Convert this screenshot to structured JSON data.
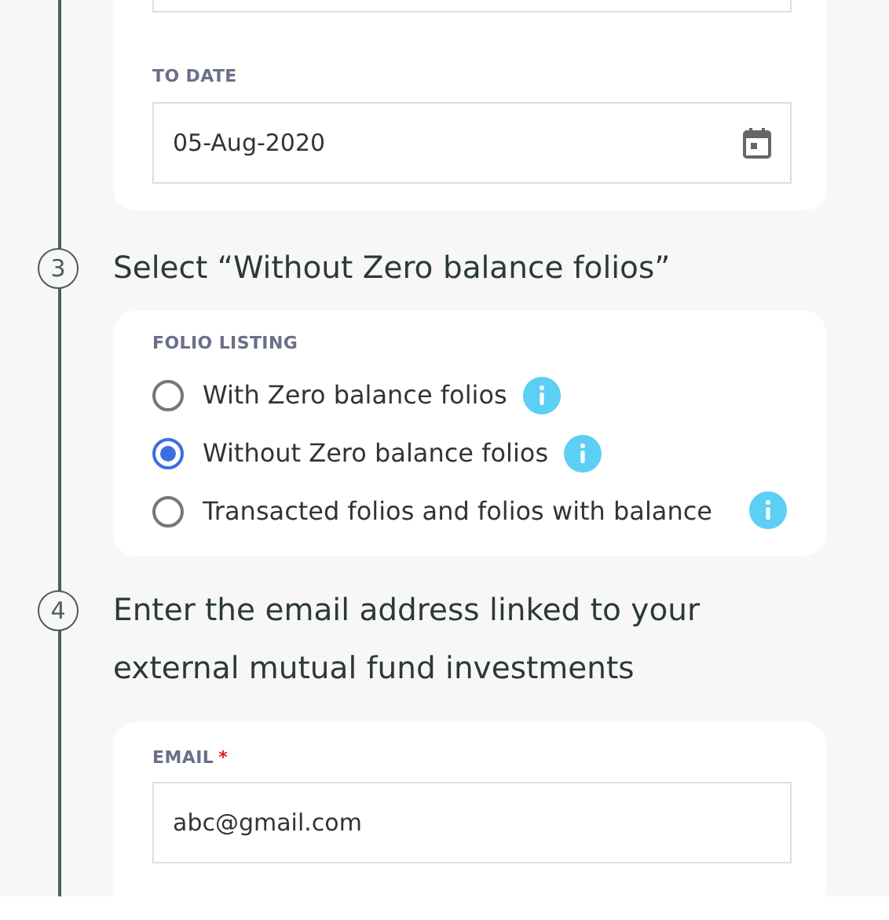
{
  "to_date": {
    "label": "TO DATE",
    "value": "05-Aug-2020"
  },
  "step_3": {
    "number": "3",
    "text": "Select “Without Zero balance folios”"
  },
  "folio_listing": {
    "label": "FOLIO LISTING",
    "options": [
      {
        "label": "With Zero balance folios",
        "selected": false
      },
      {
        "label": "Without Zero balance folios",
        "selected": true
      },
      {
        "label": "Transacted folios and folios with balance",
        "selected": false
      }
    ]
  },
  "step_4": {
    "number": "4",
    "text": "Enter the email address linked to your external mutual fund investments"
  },
  "email": {
    "label": "EMAIL",
    "required_mark": "*",
    "value": "abc@gmail.com"
  }
}
